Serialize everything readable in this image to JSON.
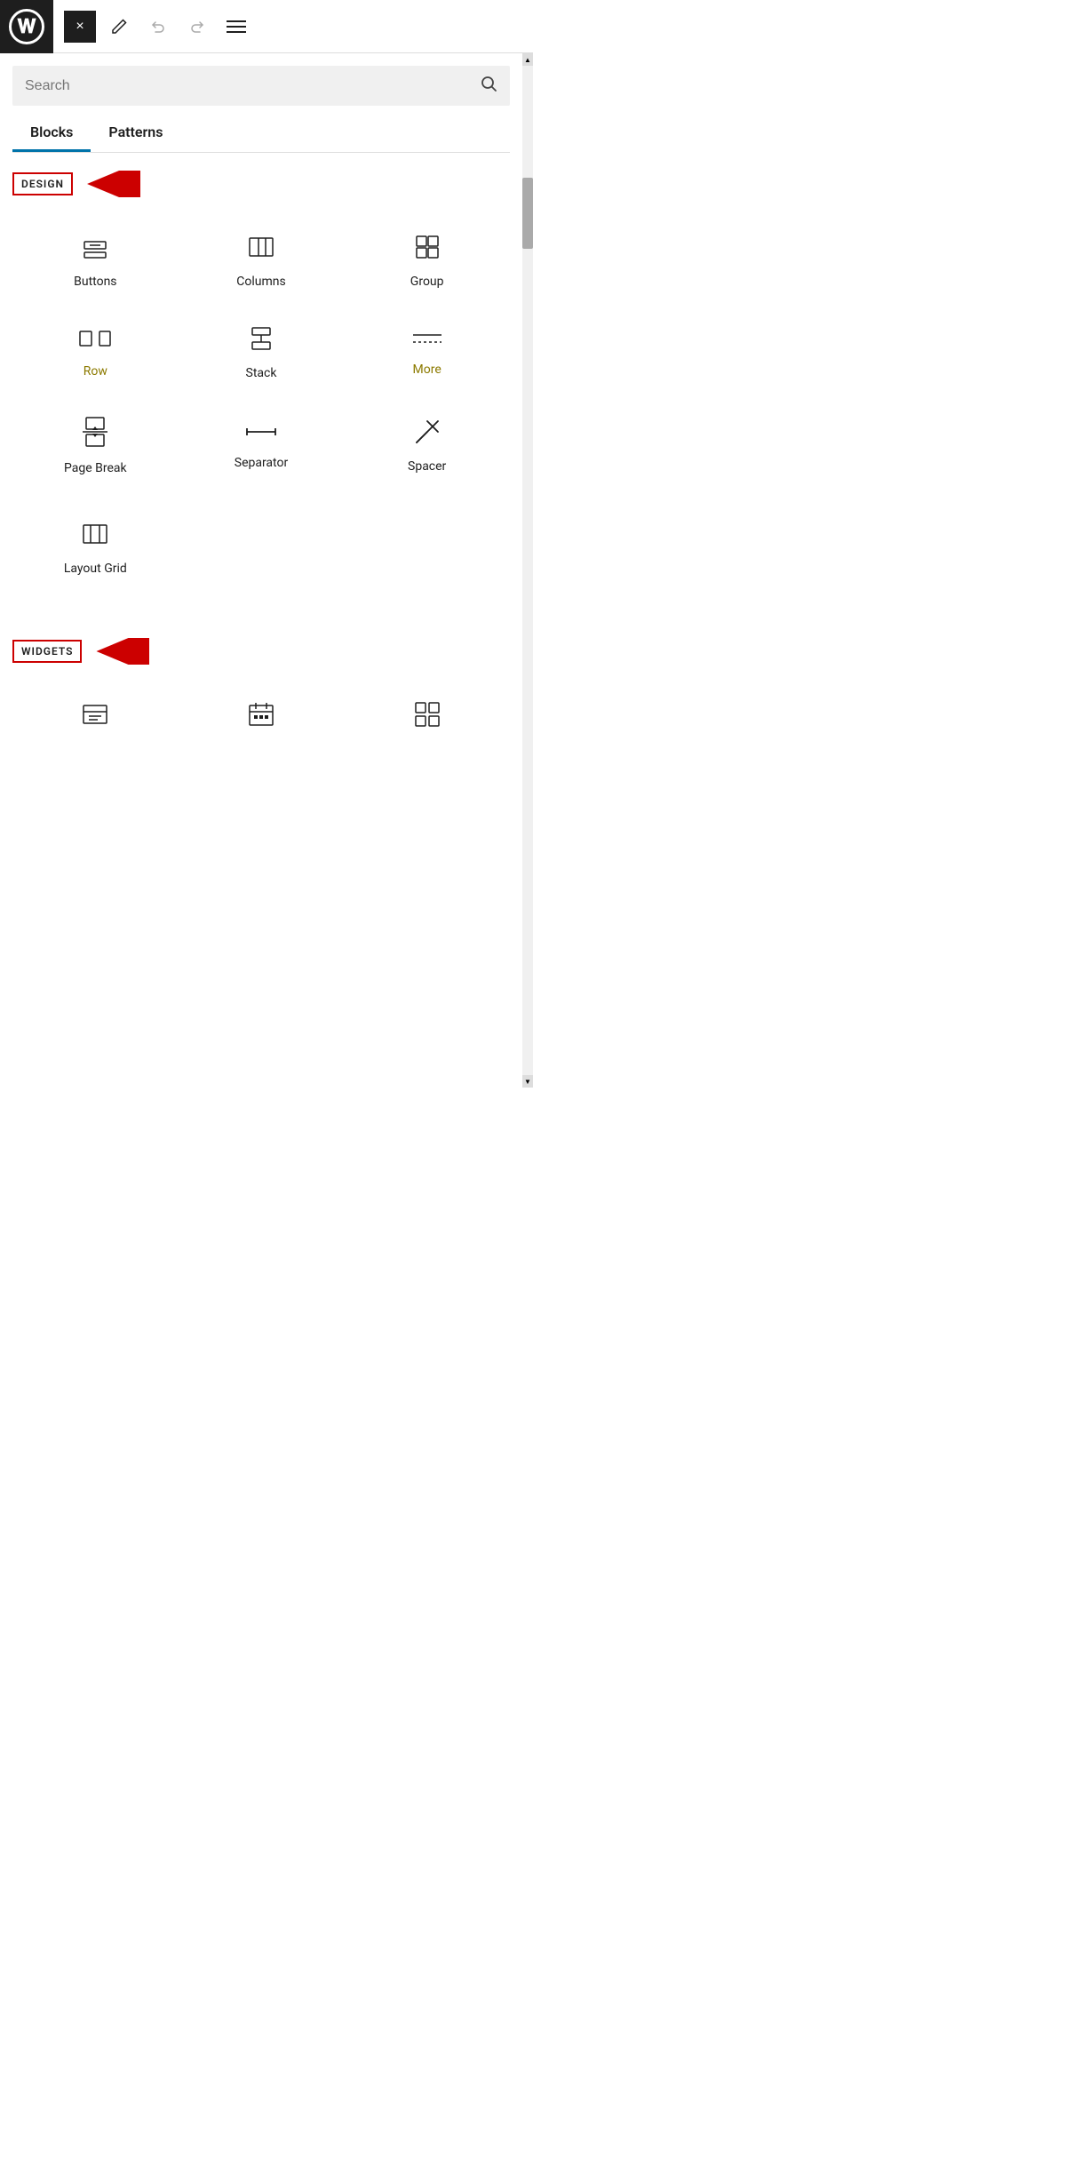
{
  "toolbar": {
    "close_label": "×",
    "edit_icon": "✏",
    "undo_icon": "↩",
    "redo_icon": "↪",
    "menu_icon": "≡"
  },
  "search": {
    "placeholder": "Search",
    "icon": "🔍"
  },
  "tabs": [
    {
      "id": "blocks",
      "label": "Blocks",
      "active": true
    },
    {
      "id": "patterns",
      "label": "Patterns",
      "active": false
    }
  ],
  "sections": [
    {
      "id": "design",
      "label": "DESIGN",
      "has_arrow": true,
      "blocks": [
        {
          "id": "buttons",
          "label": "Buttons",
          "icon": "buttons"
        },
        {
          "id": "columns",
          "label": "Columns",
          "icon": "columns"
        },
        {
          "id": "group",
          "label": "Group",
          "icon": "group"
        },
        {
          "id": "row",
          "label": "Row",
          "icon": "row",
          "highlight": true
        },
        {
          "id": "stack",
          "label": "Stack",
          "icon": "stack",
          "highlight": false
        },
        {
          "id": "more",
          "label": "More",
          "icon": "more",
          "highlight": true
        },
        {
          "id": "page-break",
          "label": "Page Break",
          "icon": "page-break"
        },
        {
          "id": "separator",
          "label": "Separator",
          "icon": "separator"
        },
        {
          "id": "spacer",
          "label": "Spacer",
          "icon": "spacer"
        },
        {
          "id": "layout-grid",
          "label": "Layout Grid",
          "icon": "layout-grid"
        }
      ]
    },
    {
      "id": "widgets",
      "label": "WIDGETS",
      "has_arrow": true,
      "blocks": [
        {
          "id": "archive",
          "label": "",
          "icon": "archive"
        },
        {
          "id": "calendar",
          "label": "",
          "icon": "calendar"
        },
        {
          "id": "icon-grid",
          "label": "",
          "icon": "icon-grid"
        }
      ]
    }
  ]
}
